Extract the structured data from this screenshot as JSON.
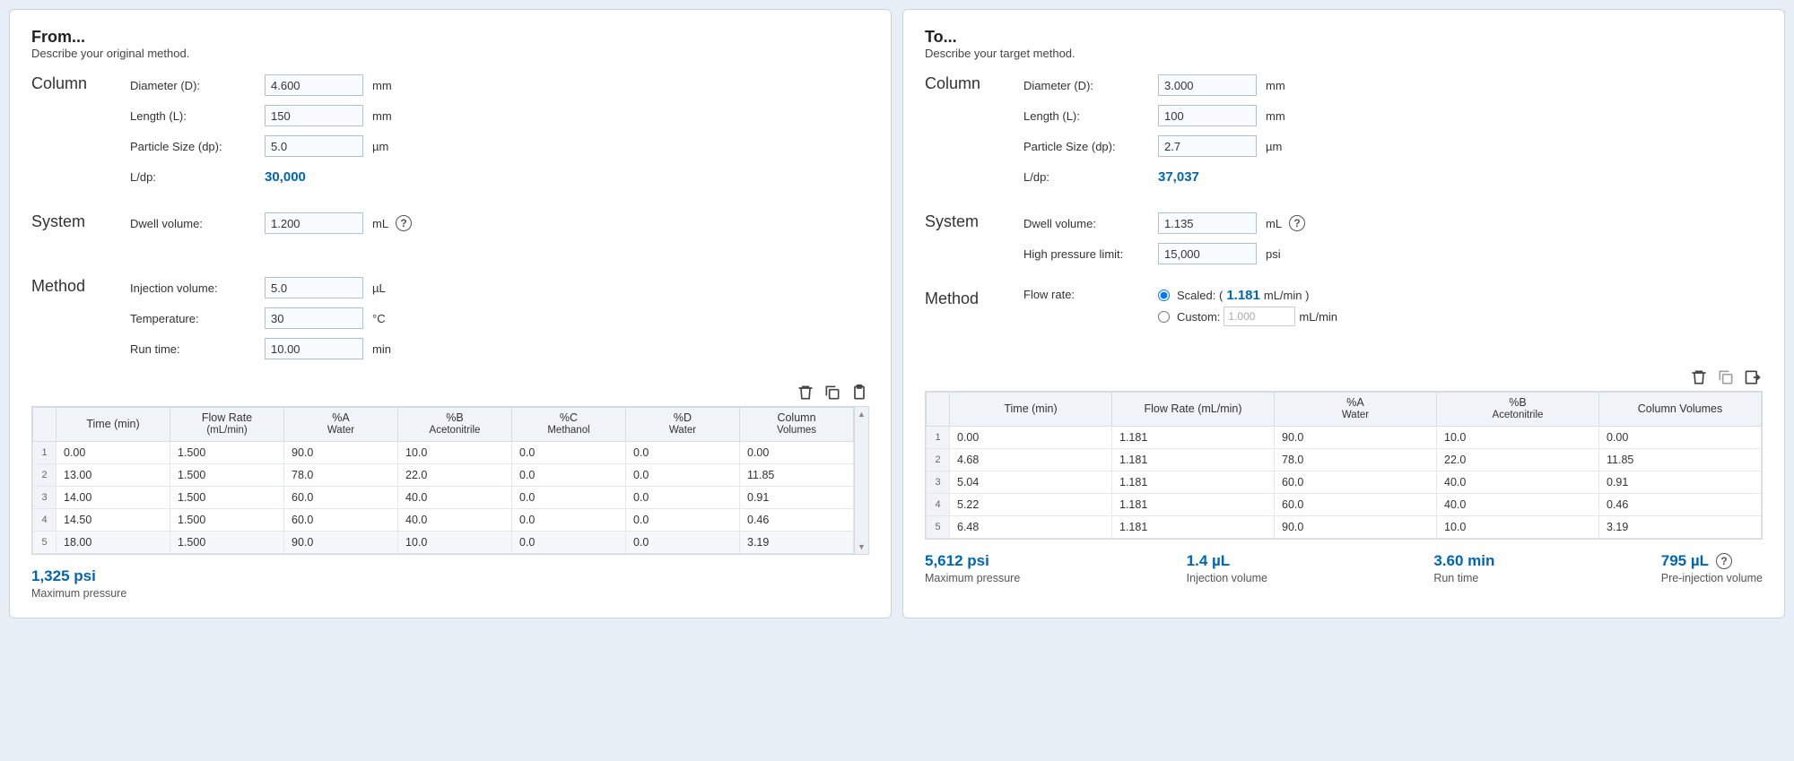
{
  "from": {
    "title": "From...",
    "subtitle": "Describe your original method.",
    "column": {
      "section": "Column",
      "diameter_label": "Diameter (D):",
      "diameter_value": "4.600",
      "diameter_unit": "mm",
      "length_label": "Length (L):",
      "length_value": "150",
      "length_unit": "mm",
      "particle_label": "Particle Size (dp):",
      "particle_value": "5.0",
      "particle_unit": "µm",
      "ldp_label": "L/dp:",
      "ldp_value": "30,000"
    },
    "system": {
      "section": "System",
      "dwell_label": "Dwell volume:",
      "dwell_value": "1.200",
      "dwell_unit": "mL"
    },
    "method": {
      "section": "Method",
      "inj_label": "Injection volume:",
      "inj_value": "5.0",
      "inj_unit": "µL",
      "temp_label": "Temperature:",
      "temp_value": "30",
      "temp_unit": "°C",
      "run_label": "Run time:",
      "run_value": "10.00",
      "run_unit": "min"
    },
    "table": {
      "headers": {
        "time": "Time (min)",
        "flow1": "Flow Rate",
        "flow2": "(mL/min)",
        "a1": "%A",
        "a2": "Water",
        "b1": "%B",
        "b2": "Acetonitrile",
        "c1": "%C",
        "c2": "Methanol",
        "d1": "%D",
        "d2": "Water",
        "cv1": "Column",
        "cv2": "Volumes"
      },
      "rows": [
        {
          "n": "1",
          "time": "0.00",
          "flow": "1.500",
          "a": "90.0",
          "b": "10.0",
          "c": "0.0",
          "d": "0.0",
          "cv": "0.00"
        },
        {
          "n": "2",
          "time": "13.00",
          "flow": "1.500",
          "a": "78.0",
          "b": "22.0",
          "c": "0.0",
          "d": "0.0",
          "cv": "11.85"
        },
        {
          "n": "3",
          "time": "14.00",
          "flow": "1.500",
          "a": "60.0",
          "b": "40.0",
          "c": "0.0",
          "d": "0.0",
          "cv": "0.91"
        },
        {
          "n": "4",
          "time": "14.50",
          "flow": "1.500",
          "a": "60.0",
          "b": "40.0",
          "c": "0.0",
          "d": "0.0",
          "cv": "0.46"
        },
        {
          "n": "5",
          "time": "18.00",
          "flow": "1.500",
          "a": "90.0",
          "b": "10.0",
          "c": "0.0",
          "d": "0.0",
          "cv": "3.19"
        }
      ]
    },
    "summary": {
      "maxp_val": "1,325 psi",
      "maxp_label": "Maximum pressure"
    }
  },
  "to": {
    "title": "To...",
    "subtitle": "Describe your target method.",
    "column": {
      "section": "Column",
      "diameter_label": "Diameter (D):",
      "diameter_value": "3.000",
      "diameter_unit": "mm",
      "length_label": "Length (L):",
      "length_value": "100",
      "length_unit": "mm",
      "particle_label": "Particle Size (dp):",
      "particle_value": "2.7",
      "particle_unit": "µm",
      "ldp_label": "L/dp:",
      "ldp_value": "37,037"
    },
    "system": {
      "section": "System",
      "dwell_label": "Dwell volume:",
      "dwell_value": "1.135",
      "dwell_unit": "mL",
      "hpl_label": "High pressure limit:",
      "hpl_value": "15,000",
      "hpl_unit": "psi"
    },
    "method": {
      "section": "Method",
      "flow_label": "Flow rate:",
      "scaled_prefix": "Scaled: (",
      "scaled_value": "1.181",
      "scaled_suffix": " mL/min )",
      "custom_label": "Custom:",
      "custom_value": "1.000",
      "custom_unit": "mL/min"
    },
    "table": {
      "headers": {
        "time": "Time (min)",
        "flow": "Flow Rate (mL/min)",
        "a1": "%A",
        "a2": "Water",
        "b1": "%B",
        "b2": "Acetonitrile",
        "cv": "Column Volumes"
      },
      "rows": [
        {
          "n": "1",
          "time": "0.00",
          "flow": "1.181",
          "a": "90.0",
          "b": "10.0",
          "cv": "0.00"
        },
        {
          "n": "2",
          "time": "4.68",
          "flow": "1.181",
          "a": "78.0",
          "b": "22.0",
          "cv": "11.85"
        },
        {
          "n": "3",
          "time": "5.04",
          "flow": "1.181",
          "a": "60.0",
          "b": "40.0",
          "cv": "0.91"
        },
        {
          "n": "4",
          "time": "5.22",
          "flow": "1.181",
          "a": "60.0",
          "b": "40.0",
          "cv": "0.46"
        },
        {
          "n": "5",
          "time": "6.48",
          "flow": "1.181",
          "a": "90.0",
          "b": "10.0",
          "cv": "3.19"
        }
      ]
    },
    "summary": {
      "maxp_val": "5,612 psi",
      "maxp_label": "Maximum pressure",
      "inj_val": "1.4  µL",
      "inj_label": "Injection volume",
      "run_val": "3.60  min",
      "run_label": "Run time",
      "pre_val": "795  µL",
      "pre_label": "Pre-injection volume"
    }
  }
}
